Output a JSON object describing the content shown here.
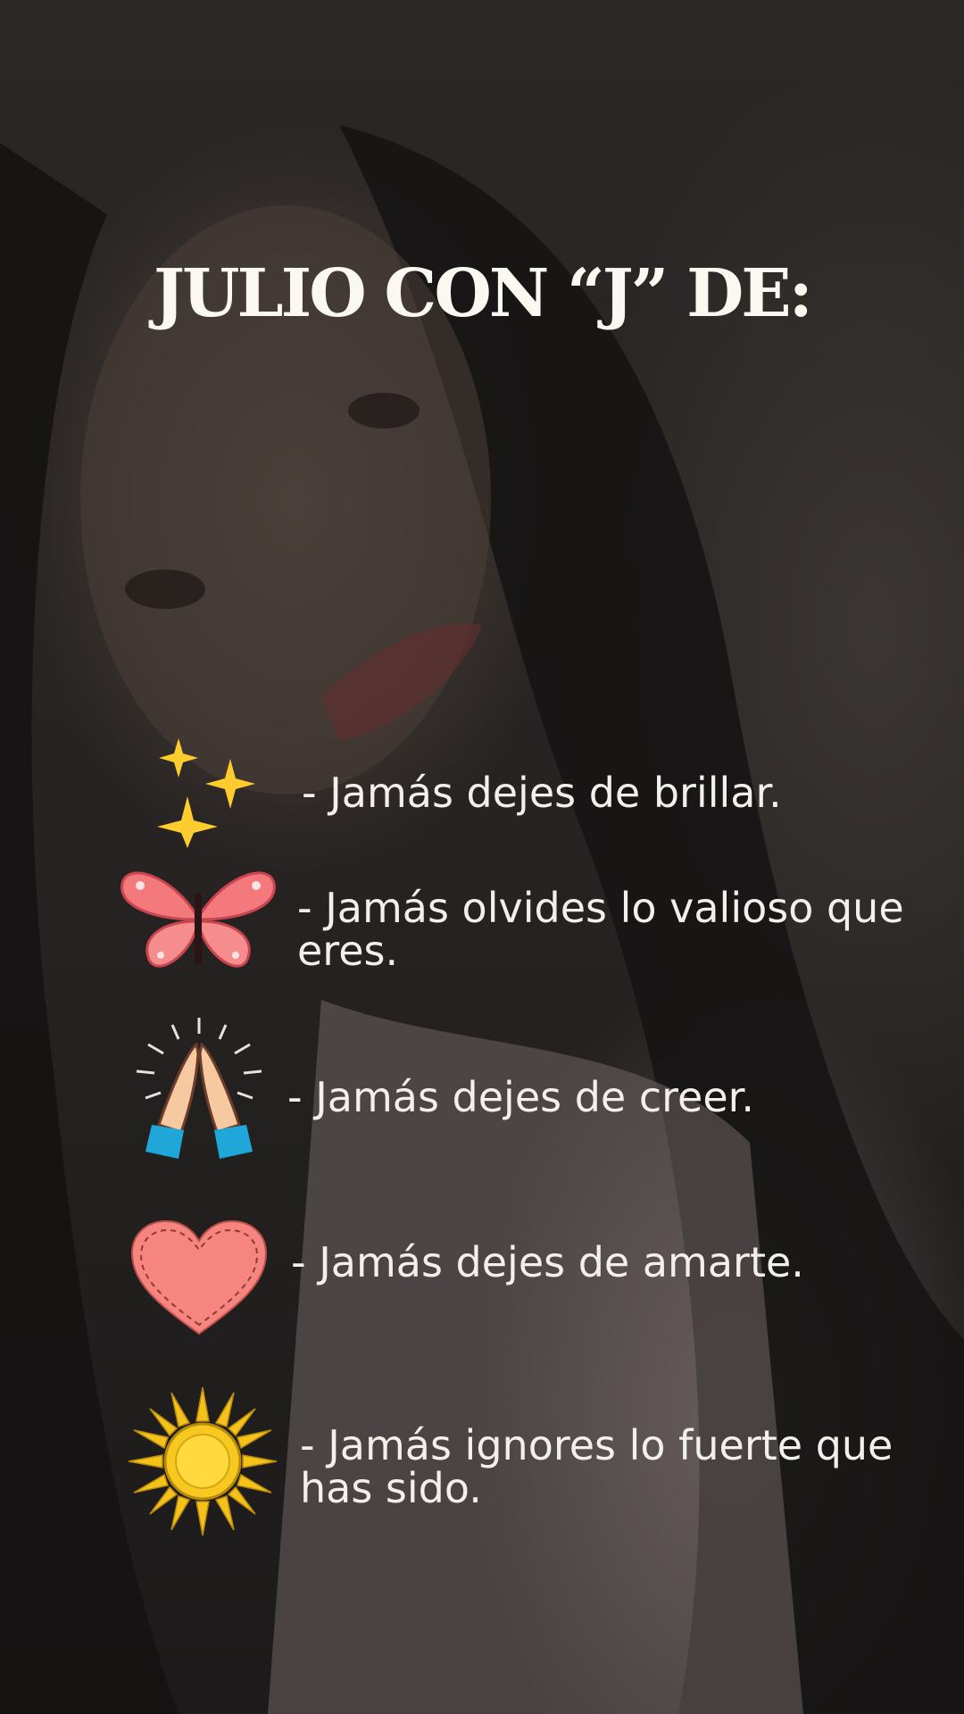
{
  "title": "JULIO CON “J” DE:",
  "items": [
    {
      "icon": "sparkles-icon",
      "text": "- Jamás dejes de brillar."
    },
    {
      "icon": "butterfly-icon",
      "text": "- Jamás olvides lo valioso que eres."
    },
    {
      "icon": "praying-hands-icon",
      "text": "- Jamás dejes de creer."
    },
    {
      "icon": "heart-icon",
      "text": "- Jamás dejes de amarte."
    },
    {
      "icon": "sun-icon",
      "text": "- Jamás ignores lo fuerte que has sido."
    }
  ]
}
